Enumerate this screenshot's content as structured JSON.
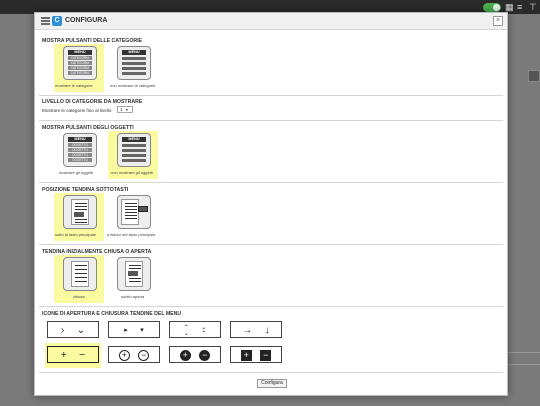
{
  "dialog": {
    "title": "CONFIGURA",
    "close_glyph": "×",
    "logo_glyph": "C",
    "configure_button": "Configura"
  },
  "sections": {
    "category_buttons": {
      "title": "MOSTRA PULSANTI DELLE CATEGORIE",
      "options": [
        {
          "caption": "mostrare le categorie",
          "selected": true,
          "menu_head": "MENU",
          "rows": [
            "CATEGORIA",
            "CATEGORIA",
            "CATEGORIA",
            "CATEGORIA"
          ]
        },
        {
          "caption": "non mostrare le categorie",
          "selected": false,
          "menu_head": "MENU"
        }
      ]
    },
    "category_level": {
      "title": "LIVELLO DI CATEGORIE DA MOSTRARE",
      "label": "Mostrare le categorie fino al livello",
      "value": "1"
    },
    "object_buttons": {
      "title": "MOSTRA PULSANTI DEGLI OGGETTI",
      "options": [
        {
          "caption": "mostrare gli oggetti",
          "selected": false,
          "menu_head": "MENU",
          "rows": [
            "OGGETTO",
            "OGGETTO",
            "OGGETTO",
            "OGGETTO"
          ]
        },
        {
          "caption": "non mostrare gli oggetti",
          "selected": true,
          "menu_head": "MENU"
        }
      ]
    },
    "submenu_position": {
      "title": "POSIZIONE TENDINA SOTTOTASTI",
      "options": [
        {
          "caption": "sotto al tasto principale",
          "selected": true
        },
        {
          "caption": "a fianco del tasto principale",
          "selected": false
        }
      ]
    },
    "submenu_state": {
      "title": "TENDINA INIZIALMENTE CHIUSA O APERTA",
      "options": [
        {
          "caption": "chiusa",
          "selected": true
        },
        {
          "caption": "subito aperta",
          "selected": false
        }
      ]
    },
    "menu_icons": {
      "title": "ICONE DI APERTURA E CHIUSURA TENDINE DEL MENU",
      "rows": [
        [
          {
            "name": "chevron-right-down",
            "open": "›",
            "close": "⌄",
            "selected": false
          },
          {
            "name": "triangle-right-down",
            "open": "▸",
            "close": "▾",
            "selected": false
          },
          {
            "name": "double-chevron",
            "open": "⌃",
            "close": "⌄",
            "selected": false
          },
          {
            "name": "arrow-right-down",
            "open": "→",
            "close": "↓",
            "selected": false
          }
        ],
        [
          {
            "name": "plus-minus",
            "open": "+",
            "close": "−",
            "selected": true
          },
          {
            "name": "plus-minus-circle",
            "open": "+",
            "close": "−",
            "selected": false
          },
          {
            "name": "plus-minus-circle-filled",
            "open": "+",
            "close": "−",
            "selected": false
          },
          {
            "name": "plus-minus-square-filled",
            "open": "+",
            "close": "−",
            "selected": false
          }
        ]
      ]
    }
  },
  "colors": {
    "highlight": "#fafaa0",
    "accent": "#2c8fd6"
  }
}
